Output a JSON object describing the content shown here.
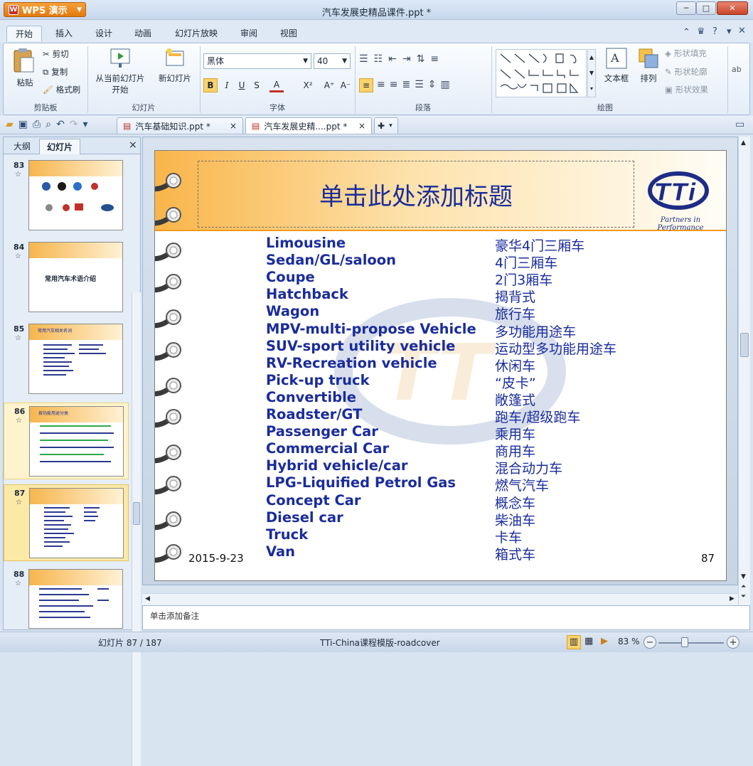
{
  "app": {
    "button_label": "WPS 演示",
    "window_title": "汽车发展史精品课件.ppt *"
  },
  "window_controls": {
    "minimize": "─",
    "maximize": "□",
    "close": "✕"
  },
  "menu": {
    "tabs": [
      "开始",
      "插入",
      "设计",
      "动画",
      "幻灯片放映",
      "审阅",
      "视图"
    ],
    "active": "开始"
  },
  "ribbon": {
    "clipboard": {
      "paste": "粘贴",
      "cut": "剪切",
      "copy": "复制",
      "format_painter": "格式刷",
      "group": "剪贴板"
    },
    "slides": {
      "from_current": "从当前幻灯片",
      "from_current_2": "开始",
      "new_slide": "新幻灯片",
      "group": "幻灯片"
    },
    "font": {
      "name": "黑体",
      "size": "40",
      "group": "字体",
      "bold": "B",
      "italic": "I",
      "underline": "U",
      "shadow": "S",
      "color": "A",
      "super": "X²",
      "grow": "A⁺",
      "shrink": "A⁻"
    },
    "paragraph": {
      "group": "段落"
    },
    "drawing": {
      "textbox": "文本框",
      "arrange": "排列",
      "shape_fill": "形状填充",
      "shape_outline": "形状轮廓",
      "shape_effects": "形状效果",
      "group": "绘图"
    }
  },
  "doc_tabs": [
    {
      "label": "汽车基础知识.ppt *",
      "close": "×"
    },
    {
      "label": "汽车发展史精....ppt *",
      "close": "×"
    }
  ],
  "left_pane": {
    "tabs": [
      "大纲",
      "幻灯片"
    ],
    "active": "幻灯片",
    "close": "×",
    "thumbs": [
      {
        "num": "83",
        "star": "☆",
        "title": ""
      },
      {
        "num": "84",
        "star": "☆",
        "title": "常用汽车术语介绍"
      },
      {
        "num": "85",
        "star": "☆",
        "title": "常用汽车相关名词"
      },
      {
        "num": "86",
        "star": "☆",
        "title": "按功能用途分类"
      },
      {
        "num": "87",
        "star": "☆",
        "title": ""
      },
      {
        "num": "88",
        "star": "☆",
        "title": ""
      }
    ]
  },
  "slide": {
    "title": "单击此处添加标题",
    "logo_text": "TTi",
    "logo_tagline": "Partners in Performance",
    "terms": [
      {
        "en": "Limousine",
        "zh": "豪华4门三厢车"
      },
      {
        "en": "Sedan/GL/saloon",
        "zh": "4门三厢车"
      },
      {
        "en": "Coupe",
        "zh": "2门3厢车"
      },
      {
        "en": "Hatchback",
        "zh": "揭背式"
      },
      {
        "en": "Wagon",
        "zh": "旅行车"
      },
      {
        "en": "MPV-multi-propose Vehicle",
        "zh": "多功能用途车"
      },
      {
        "en": "SUV-sport utility vehicle",
        "zh": "运动型多功能用途车"
      },
      {
        "en": "RV-Recreation vehicle",
        "zh": "休闲车"
      },
      {
        "en": "Pick-up truck",
        "zh": "“皮卡”"
      },
      {
        "en": "Convertible",
        "zh": "敞篷式"
      },
      {
        "en": "Roadster/GT",
        "zh": "跑车/超级跑车"
      },
      {
        "en": "Passenger Car",
        "zh": "乘用车"
      },
      {
        "en": "Commercial Car",
        "zh": "商用车"
      },
      {
        "en": "Hybrid vehicle/car",
        "zh": "混合动力车"
      },
      {
        "en": "LPG-Liquified Petrol Gas",
        "zh": "燃气汽车"
      },
      {
        "en": "Concept Car",
        "zh": "概念车"
      },
      {
        "en": "Diesel car",
        "zh": "柴油车"
      },
      {
        "en": "Truck",
        "zh": "卡车"
      },
      {
        "en": "Van",
        "zh": "箱式车"
      }
    ],
    "date": "2015-9-23",
    "number": "87"
  },
  "notes": {
    "placeholder": "单击添加备注"
  },
  "status": {
    "slide_info": "幻灯片 87 / 187",
    "template": "TTi-China课程模版-roadcover",
    "zoom": "83 %"
  },
  "colors": {
    "accent": "#1a2c9c",
    "header_orange": "#f9b54a"
  }
}
